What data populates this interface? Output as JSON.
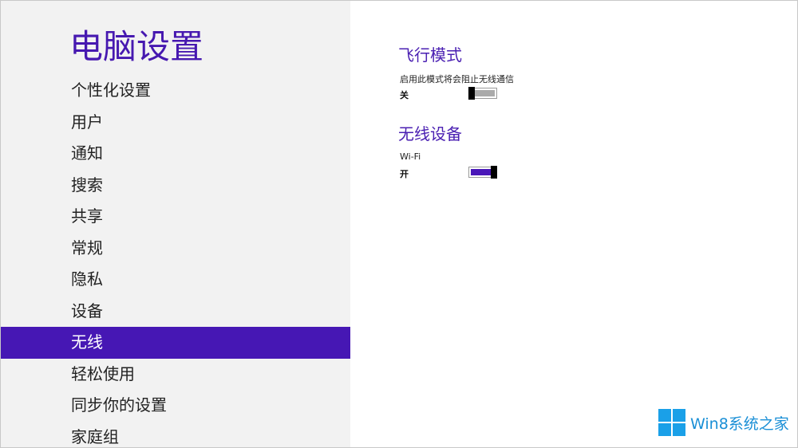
{
  "sidebar": {
    "title": "电脑设置",
    "items": [
      {
        "label": "个性化设置"
      },
      {
        "label": "用户"
      },
      {
        "label": "通知"
      },
      {
        "label": "搜索"
      },
      {
        "label": "共享"
      },
      {
        "label": "常规"
      },
      {
        "label": "隐私"
      },
      {
        "label": "设备"
      },
      {
        "label": "无线",
        "active": true
      },
      {
        "label": "轻松使用"
      },
      {
        "label": "同步你的设置"
      },
      {
        "label": "家庭组"
      }
    ]
  },
  "main": {
    "airplane": {
      "heading": "飞行模式",
      "description": "启用此模式将会阻止无线通信",
      "state": "关",
      "on": false
    },
    "wireless": {
      "heading": "无线设备",
      "device_name": "Wi-Fi",
      "state": "开",
      "on": true
    }
  },
  "watermark": {
    "text": "Win8系统之家",
    "icon": "windows-logo-icon"
  },
  "colors": {
    "accent": "#4617b4",
    "sidebar_bg": "#f2f2f2",
    "watermark": "#1aa0e8"
  }
}
